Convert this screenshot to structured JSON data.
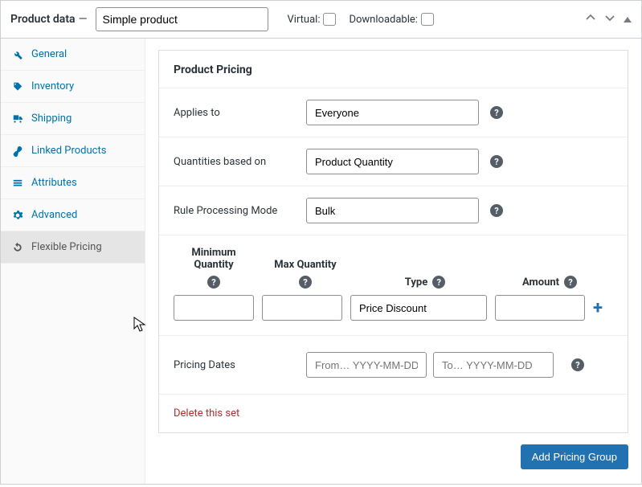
{
  "header": {
    "label": "Product data",
    "dash": "—",
    "type": "Simple product",
    "virtual_label": "Virtual:",
    "downloadable_label": "Downloadable:"
  },
  "sidebar": {
    "items": [
      {
        "label": "General"
      },
      {
        "label": "Inventory"
      },
      {
        "label": "Shipping"
      },
      {
        "label": "Linked Products"
      },
      {
        "label": "Attributes"
      },
      {
        "label": "Advanced"
      },
      {
        "label": "Flexible Pricing"
      }
    ]
  },
  "pricing": {
    "title": "Product Pricing",
    "applies_to_label": "Applies to",
    "applies_to_value": "Everyone",
    "qty_based_label": "Quantities based on",
    "qty_based_value": "Product Quantity",
    "mode_label": "Rule Processing Mode",
    "mode_value": "Bulk",
    "cols": {
      "min": "Minimum Quantity",
      "max": "Max Quantity",
      "type": "Type",
      "amount": "Amount"
    },
    "type_value": "Price Discount",
    "dates_label": "Pricing Dates",
    "from_placeholder": "From… YYYY-MM-DD",
    "to_placeholder": "To… YYYY-MM-DD",
    "delete": "Delete this set",
    "add_button": "Add Pricing Group"
  }
}
